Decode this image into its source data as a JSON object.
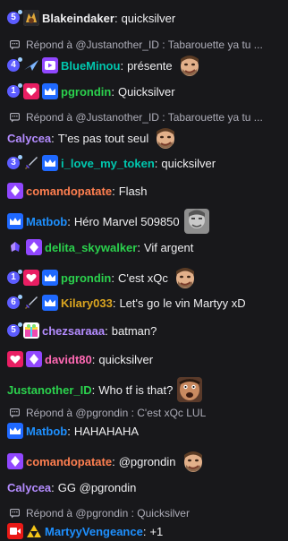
{
  "colors": {
    "background": "#18181b",
    "text": "#efeff1",
    "reply_text": "#adadb8",
    "name_white": "#efeff1",
    "name_cyan": "#00c8af",
    "name_green": "#2bd14d",
    "name_purple": "#b48cff",
    "name_orange": "#ff7f50",
    "name_blue": "#1e90ff",
    "name_gold": "#daa520",
    "name_pink": "#ff69b4",
    "name_violet": "#9d64ff"
  },
  "messages": [
    {
      "type": "msg",
      "badges": [
        "num:5",
        "sub1"
      ],
      "name": "Blakeindaker",
      "name_color": "#efeff1",
      "text": "quicksilver"
    },
    {
      "type": "reply",
      "text": "Répond à @Justanother_ID : Tabarouette ya tu ..."
    },
    {
      "type": "msg",
      "badges": [
        "num:4",
        "plane",
        "video-purple"
      ],
      "name": "BlueMinou",
      "name_color": "#00c8af",
      "text": "présente",
      "emote": "face"
    },
    {
      "type": "msg",
      "badges": [
        "num:1",
        "heart",
        "crown"
      ],
      "name": "pgrondin",
      "name_color": "#2bd14d",
      "text": "Quicksilver"
    },
    {
      "type": "reply",
      "text": "Répond à @Justanother_ID : Tabarouette ya tu ..."
    },
    {
      "type": "msg",
      "badges": [],
      "name": "Calycea",
      "name_color": "#b48cff",
      "text": "T'es pas tout seul",
      "emote": "face"
    },
    {
      "type": "msg",
      "badges": [
        "num:3",
        "sword",
        "crown"
      ],
      "name": "i_love_my_token",
      "name_color": "#00c8af",
      "text": "quicksilver"
    },
    {
      "type": "msg",
      "badges": [
        "gem"
      ],
      "name": "comandopatate",
      "name_color": "#ff7f50",
      "text": "Flash"
    },
    {
      "type": "msg",
      "badges": [
        "crown"
      ],
      "name": "Matbob",
      "name_color": "#1e90ff",
      "text": "Héro Marvel 509850",
      "emote": "gray-face"
    },
    {
      "type": "msg",
      "badges": [
        "wing",
        "gem"
      ],
      "name": "delita_skywalker",
      "name_color": "#2bd14d",
      "text": "Vif argent"
    },
    {
      "type": "msg",
      "badges": [
        "num:1",
        "heart",
        "crown"
      ],
      "name": "pgrondin",
      "name_color": "#2bd14d",
      "text": "C'est xQc",
      "emote": "face"
    },
    {
      "type": "msg",
      "badges": [
        "num:6",
        "sword",
        "crown"
      ],
      "name": "Kilary033",
      "name_color": "#daa520",
      "text": "Let's go le vin Martyy xD"
    },
    {
      "type": "msg",
      "badges": [
        "num:5",
        "gift"
      ],
      "name": "chezsaraaa",
      "name_color": "#b48cff",
      "text": "batman?"
    },
    {
      "type": "msg",
      "badges": [
        "heart",
        "gem"
      ],
      "name": "davidt80",
      "name_color": "#ff69b4",
      "text": "quicksilver"
    },
    {
      "type": "msg",
      "badges": [],
      "name": "Justanother_ID",
      "name_color": "#2bd14d",
      "text": "Who tf is that?",
      "emote": "shock-face"
    },
    {
      "type": "reply",
      "text": "Répond à @pgrondin : C'est xQc LUL"
    },
    {
      "type": "msg",
      "badges": [
        "crown"
      ],
      "name": "Matbob",
      "name_color": "#1e90ff",
      "text": "HAHAHAHA"
    },
    {
      "type": "msg",
      "badges": [
        "gem"
      ],
      "name": "comandopatate",
      "name_color": "#ff7f50",
      "text": "@pgrondin",
      "emote": "face"
    },
    {
      "type": "msg",
      "badges": [],
      "name": "Calycea",
      "name_color": "#b48cff",
      "text": "GG @pgrondin"
    },
    {
      "type": "reply",
      "text": "Répond à @pgrondin : Quicksilver"
    },
    {
      "type": "msg",
      "badges": [
        "video",
        "triforce"
      ],
      "name": "MartyyVengeance",
      "name_color": "#1e90ff",
      "text": "+1"
    }
  ]
}
